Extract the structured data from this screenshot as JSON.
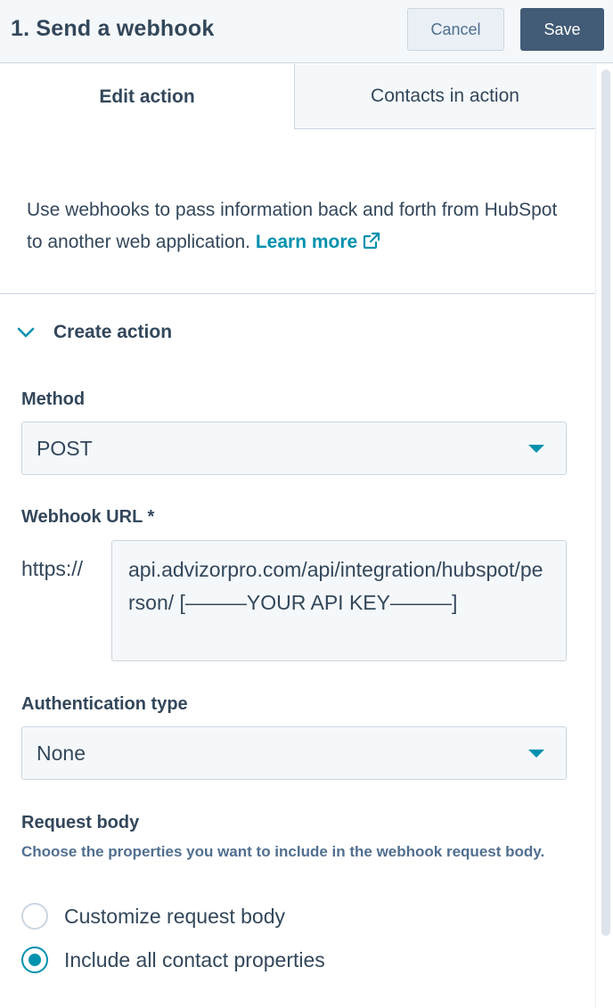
{
  "header": {
    "title": "1. Send a webhook",
    "cancel_label": "Cancel",
    "save_label": "Save"
  },
  "tabs": [
    {
      "label": "Edit action",
      "active": true
    },
    {
      "label": "Contacts in action",
      "active": false
    }
  ],
  "intro": {
    "text": "Use webhooks to pass information back and forth from HubSpot to another web application.",
    "link_label": "Learn more",
    "link_icon": "external-link-icon"
  },
  "section": {
    "title": "Create action",
    "expanded": true,
    "icon": "chevron-down-icon"
  },
  "method": {
    "label": "Method",
    "value": "POST"
  },
  "webhook_url": {
    "label": "Webhook URL *",
    "prefix": "https://",
    "value": "api.advizorpro.com/api/integration/hubspot/person/ [———YOUR API KEY———]"
  },
  "auth": {
    "label": "Authentication type",
    "value": "None"
  },
  "request_body": {
    "label": "Request body",
    "help": "Choose the properties you want to include in the webhook request body.",
    "options": [
      {
        "label": "Customize request body",
        "checked": false
      },
      {
        "label": "Include all contact properties",
        "checked": true
      }
    ]
  },
  "colors": {
    "accent": "#0091ae",
    "primary_button": "#425b76",
    "text": "#33475b",
    "border": "#cbd6e2"
  }
}
